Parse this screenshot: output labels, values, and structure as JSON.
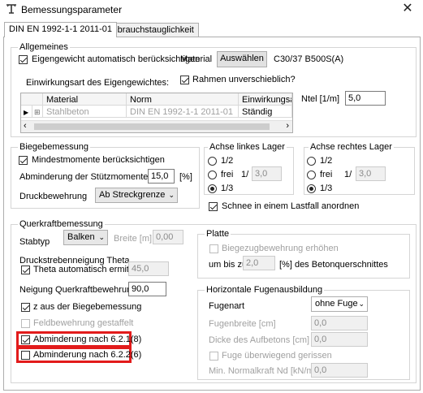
{
  "window": {
    "title": "Bemessungsparameter",
    "close_symbol": "✕"
  },
  "tabs": [
    {
      "label": "DIN EN 1992-1-1 2011-01",
      "active": true
    },
    {
      "label": "Gebrauchstauglichkeit",
      "active": false
    }
  ],
  "allgemeines": {
    "legend": "Allgemeines",
    "eigengewicht_label": "Eigengewicht automatisch berücksichtigen",
    "eigengewicht_checked": true,
    "material_label": "Material",
    "auswaehlen_button": "Auswählen",
    "material_value": "C30/37 B500S(A)",
    "rahmen_label": "Rahmen unverschieblich?",
    "rahmen_checked": true,
    "einwirkungsart_label": "Einwirkungsart des Eigengewichtes:",
    "ntel_label": "Ntel [1/m]",
    "ntel_value": "5,0",
    "grid": {
      "headers": [
        "Material",
        "Norm",
        "Einwirkungsart"
      ],
      "row": {
        "material": "Stahlbeton",
        "norm": "DIN EN 1992-1-1 2011-01",
        "einwirkungsart": "Ständig"
      }
    }
  },
  "biegebemessung": {
    "legend": "Biegebemessung",
    "mindestmomente_label": "Mindestmomente berücksichtigen",
    "mindestmomente_checked": true,
    "abminderung_label": "Abminderung der Stützmomente um :",
    "abminderung_value": "15,0",
    "abminderung_unit": "[%]",
    "druckbewehrung_label": "Druckbewehrung",
    "druckbewehrung_value": "Ab Streckgrenze"
  },
  "achse_links": {
    "legend": "Achse linkes Lager",
    "opt_half": "1/2",
    "opt_frei": "frei",
    "frei_sep": "1/",
    "frei_value": "3,0",
    "opt_third": "1/3",
    "selected": "1/3"
  },
  "achse_rechts": {
    "legend": "Achse rechtes Lager",
    "opt_half": "1/2",
    "opt_frei": "frei",
    "frei_sep": "1/",
    "frei_value": "3,0",
    "opt_third": "1/3",
    "selected": "1/3"
  },
  "schnee": {
    "label": "Schnee in einem Lastfall anordnen",
    "checked": true
  },
  "querkraft": {
    "legend": "Querkraftbemessung",
    "stabtyp_label": "Stabtyp",
    "stabtyp_value": "Balken",
    "breite_label": "Breite [m]",
    "breite_value": "0,00",
    "druckstreben_label": "Druckstrebenneigung Theta",
    "theta_auto_label": "Theta automatisch ermitteln",
    "theta_auto_checked": true,
    "theta_value": "45,0",
    "neigung_label": "Neigung Querkraftbewehrung [°]",
    "neigung_value": "90,0",
    "z_label": "z aus der Biegebemessung",
    "z_checked": true,
    "feldbewehrung_label": "Feldbewehrung gestaffelt",
    "feldbewehrung_checked": false,
    "abm621_label": "Abminderung nach 6.2.1(8)",
    "abm621_checked": true,
    "abm622_label": "Abminderung nach 6.2.2(6)",
    "abm622_checked": false
  },
  "platte": {
    "legend": "Platte",
    "biegezug_label": "Biegezugbewehrung erhöhen",
    "bis_label": "um bis zu",
    "bis_value": "2,0",
    "bis_suffix": "[%] des Betonquerschnittes"
  },
  "fugen": {
    "legend": "Horizontale Fugenausbildung",
    "fugenart_label": "Fugenart",
    "fugenart_value": "ohne Fuge",
    "fugenbreite_label": "Fugenbreite [cm]",
    "fugenbreite_value": "0,0",
    "dicke_label": "Dicke des Aufbetons [cm]",
    "dicke_value": "0,0",
    "gerissen_label": "Fuge überwiegend gerissen",
    "normalkraft_label": "Min. Normalkraft Nd [kN/m]",
    "normalkraft_value": "0,0"
  },
  "colors": {
    "highlight": "#e21b1b",
    "disabled_text": "#a0a0a0"
  }
}
